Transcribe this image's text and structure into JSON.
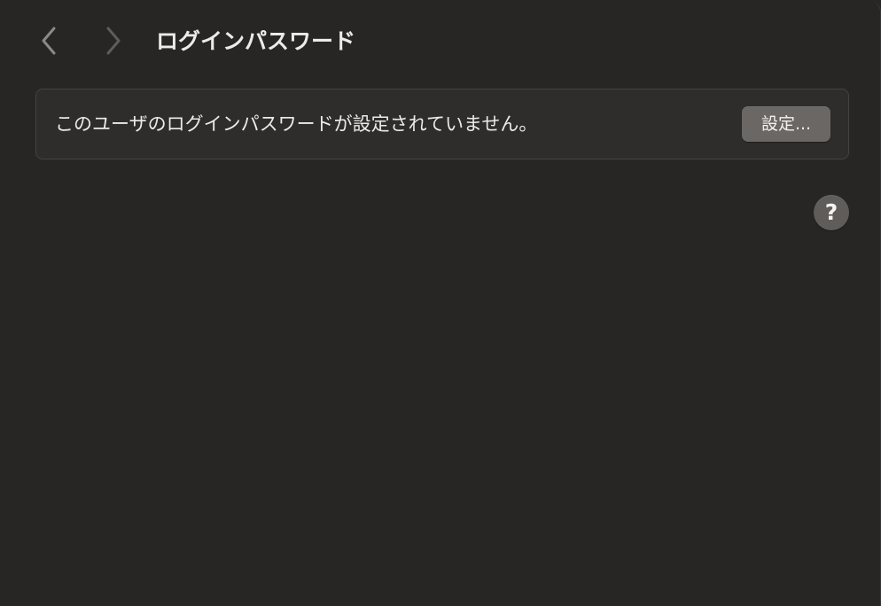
{
  "toolbar": {
    "title": "ログインパスワード",
    "back_icon": "chevron-left-icon",
    "forward_icon": "chevron-right-icon"
  },
  "panel": {
    "message": "このユーザのログインパスワードが設定されていません。",
    "button_label": "設定..."
  },
  "help": {
    "label": "?",
    "icon": "help-icon"
  },
  "colors": {
    "background": "#282624",
    "panel_background": "#2f2d2b",
    "panel_border": "#45423f",
    "button_background": "#6a6764",
    "text": "#ecebea"
  }
}
